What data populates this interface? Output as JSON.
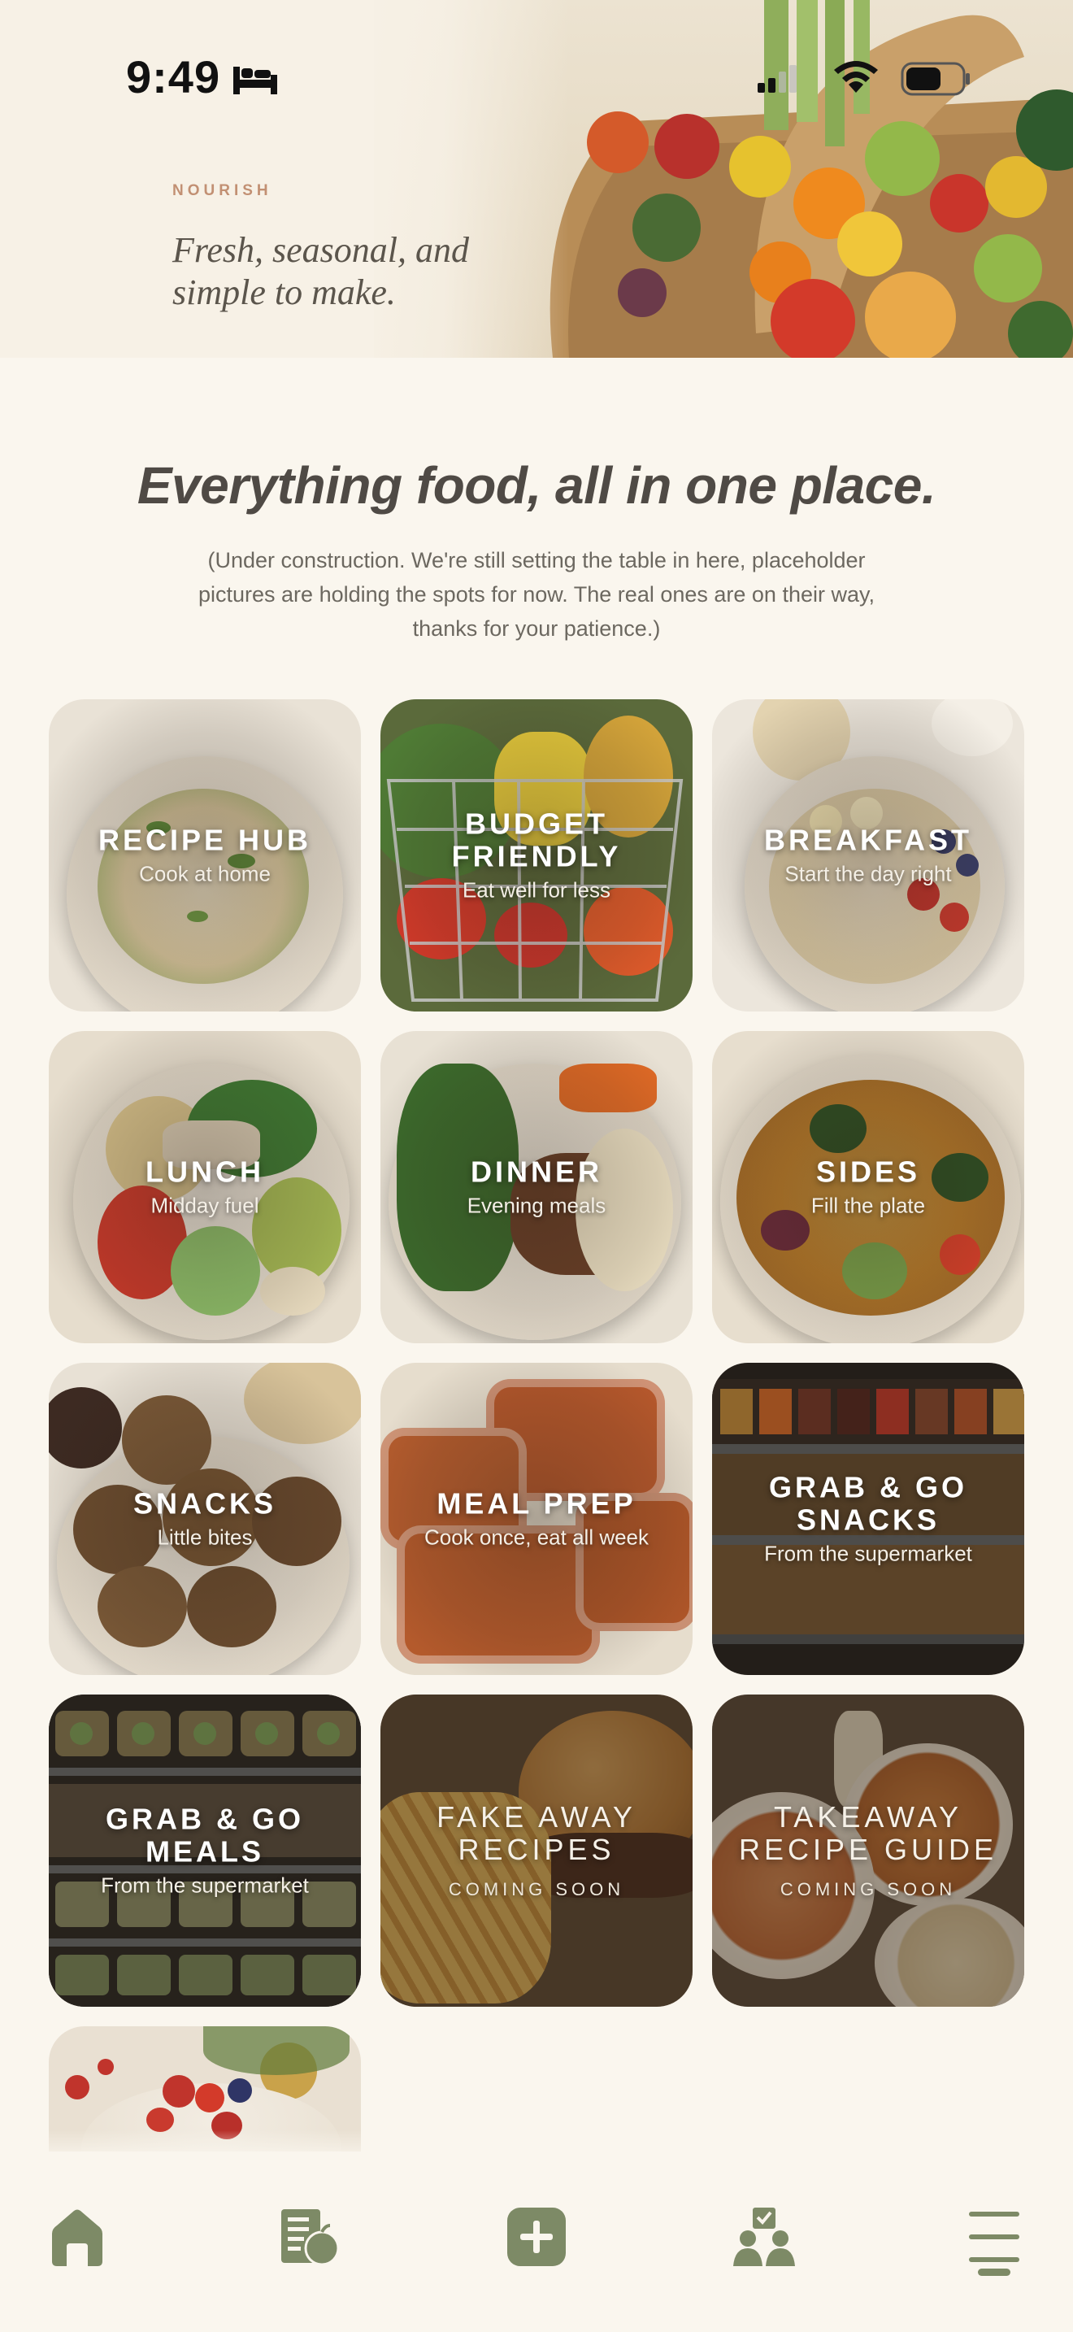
{
  "status_bar": {
    "time": "9:49"
  },
  "hero": {
    "kicker": "NOURISH",
    "tagline": "Fresh, seasonal, and simple to make."
  },
  "intro": {
    "title": "Everything food, all in one place.",
    "note": "(Under construction. We're still setting the table in here, placeholder pictures are holding the spots for now. The real ones are on their way, thanks for your patience.)"
  },
  "tiles": [
    {
      "title": "RECIPE HUB",
      "subtitle": "Cook at home"
    },
    {
      "title": "BUDGET FRIENDLY",
      "subtitle": "Eat well for less"
    },
    {
      "title": "BREAKFAST",
      "subtitle": "Start the day right"
    },
    {
      "title": "LUNCH",
      "subtitle": "Midday fuel"
    },
    {
      "title": "DINNER",
      "subtitle": "Evening meals"
    },
    {
      "title": "SIDES",
      "subtitle": "Fill the plate"
    },
    {
      "title": "SNACKS",
      "subtitle": "Little bites"
    },
    {
      "title": "MEAL PREP",
      "subtitle": "Cook once, eat all week"
    },
    {
      "title": "GRAB & GO SNACKS",
      "subtitle": "From the supermarket"
    },
    {
      "title": "GRAB & GO MEALS",
      "subtitle": "From the supermarket"
    },
    {
      "title": "FAKE AWAY RECIPES",
      "subtitle": "COMING SOON"
    },
    {
      "title": "TAKEAWAY RECIPE GUIDE",
      "subtitle": "COMING SOON"
    }
  ],
  "nav": {
    "items": [
      "home-icon",
      "recipes-icon",
      "add-icon",
      "community-icon",
      "menu-icon"
    ],
    "accent": "#7d8a66"
  }
}
